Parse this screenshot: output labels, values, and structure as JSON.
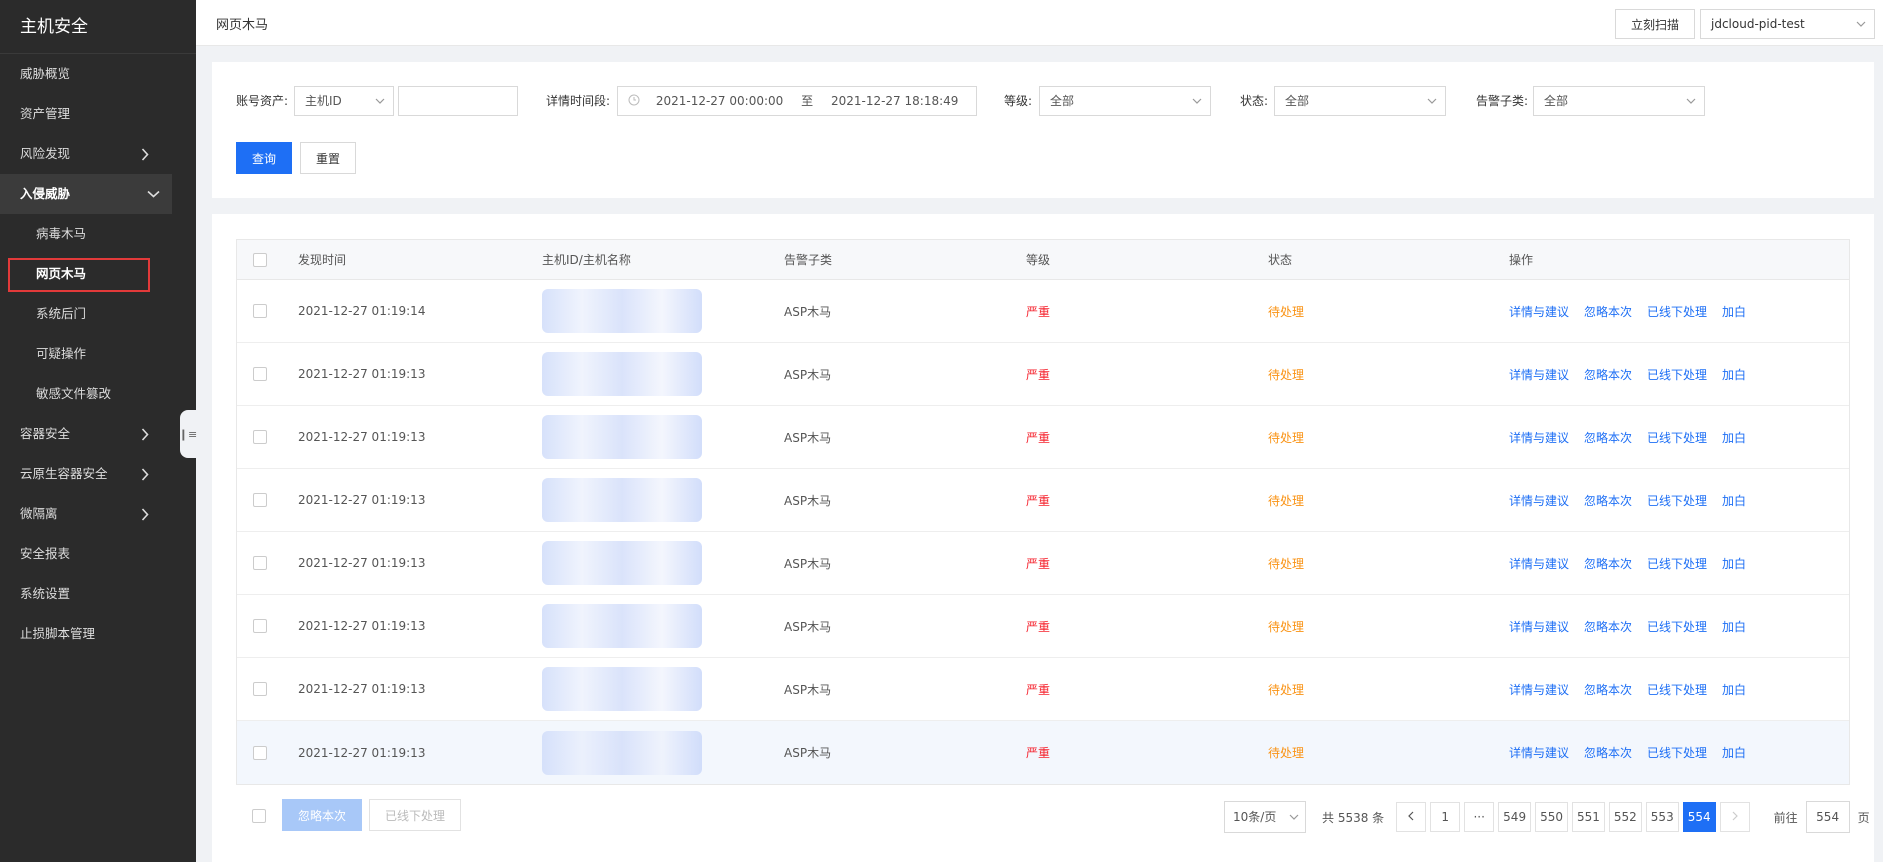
{
  "app_title": "主机安全",
  "sidebar": {
    "items": [
      {
        "label": "威胁概览",
        "name": "sidebar-item-threat-overview",
        "type": "item"
      },
      {
        "label": "资产管理",
        "name": "sidebar-item-asset-management",
        "type": "item"
      },
      {
        "label": "风险发现",
        "name": "sidebar-item-risk-discovery",
        "type": "collapsed"
      },
      {
        "label": "入侵威胁",
        "name": "sidebar-item-intrusion-threat",
        "type": "open"
      },
      {
        "label": "病毒木马",
        "name": "sidebar-item-virus-trojan",
        "type": "sub"
      },
      {
        "label": "网页木马",
        "name": "sidebar-item-webshell",
        "type": "sub-active"
      },
      {
        "label": "系统后门",
        "name": "sidebar-item-backdoor",
        "type": "sub"
      },
      {
        "label": "可疑操作",
        "name": "sidebar-item-suspicious-ops",
        "type": "sub"
      },
      {
        "label": "敏感文件篡改",
        "name": "sidebar-item-file-tamper",
        "type": "sub"
      },
      {
        "label": "容器安全",
        "name": "sidebar-item-container-security",
        "type": "collapsed"
      },
      {
        "label": "云原生容器安全",
        "name": "sidebar-item-cloud-native",
        "type": "collapsed"
      },
      {
        "label": "微隔离",
        "name": "sidebar-item-micro-isolation",
        "type": "collapsed"
      },
      {
        "label": "安全报表",
        "name": "sidebar-item-security-report",
        "type": "item"
      },
      {
        "label": "系统设置",
        "name": "sidebar-item-system-settings",
        "type": "item"
      },
      {
        "label": "止损脚本管理",
        "name": "sidebar-item-script-management",
        "type": "item"
      }
    ]
  },
  "header": {
    "page_title": "网页木马",
    "scan_button": "立刻扫描",
    "region": "jdcloud-pid-test"
  },
  "filters": {
    "asset_label": "账号资产:",
    "asset_type": "主机ID",
    "asset_value": "",
    "time_label": "详情时间段:",
    "time_start": "2021-12-27 00:00:00",
    "time_sep": "至",
    "time_end": "2021-12-27 18:18:49",
    "level_label": "等级:",
    "level_value": "全部",
    "status_label": "状态:",
    "status_value": "全部",
    "subtype_label": "告警子类:",
    "subtype_value": "全部",
    "query_button": "查询",
    "reset_button": "重置"
  },
  "table": {
    "columns": [
      "发现时间",
      "主机ID/主机名称",
      "告警子类",
      "等级",
      "状态",
      "操作"
    ],
    "actions": [
      "详情与建议",
      "忽略本次",
      "已线下处理",
      "加白"
    ],
    "rows": [
      {
        "time": "2021-12-27 01:19:14",
        "subtype": "ASP木马",
        "level": "严重",
        "status": "待处理"
      },
      {
        "time": "2021-12-27 01:19:13",
        "subtype": "ASP木马",
        "level": "严重",
        "status": "待处理"
      },
      {
        "time": "2021-12-27 01:19:13",
        "subtype": "ASP木马",
        "level": "严重",
        "status": "待处理"
      },
      {
        "time": "2021-12-27 01:19:13",
        "subtype": "ASP木马",
        "level": "严重",
        "status": "待处理"
      },
      {
        "time": "2021-12-27 01:19:13",
        "subtype": "ASP木马",
        "level": "严重",
        "status": "待处理"
      },
      {
        "time": "2021-12-27 01:19:13",
        "subtype": "ASP木马",
        "level": "严重",
        "status": "待处理"
      },
      {
        "time": "2021-12-27 01:19:13",
        "subtype": "ASP木马",
        "level": "严重",
        "status": "待处理"
      },
      {
        "time": "2021-12-27 01:19:13",
        "subtype": "ASP木马",
        "level": "严重",
        "status": "待处理"
      }
    ]
  },
  "footer": {
    "ignore_button": "忽略本次",
    "offline_button": "已线下处理",
    "page_size": "10条/页",
    "total": "共 5538 条",
    "pages": [
      "1",
      "···",
      "549",
      "550",
      "551",
      "552",
      "553",
      "554"
    ],
    "current_page": "554",
    "jump_label": "前往",
    "jump_value": "554",
    "jump_suffix": "页"
  }
}
